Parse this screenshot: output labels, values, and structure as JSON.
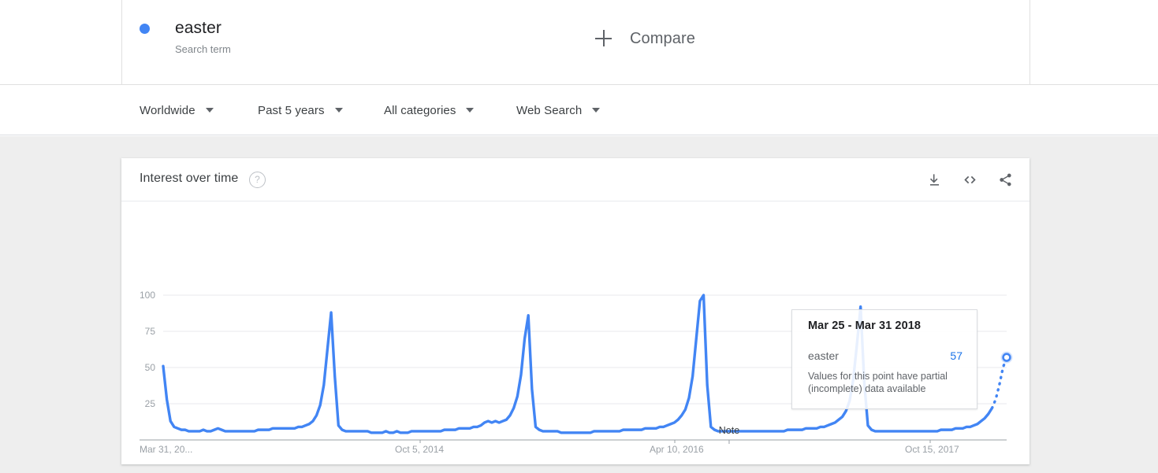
{
  "search_bar": {
    "term": {
      "name": "easter",
      "subtitle": "Search term",
      "dot_color": "#4285f4"
    },
    "compare": {
      "label": "Compare",
      "icon": "plus-icon"
    }
  },
  "filters": [
    {
      "label": "Worldwide",
      "name": "location"
    },
    {
      "label": "Past 5 years",
      "name": "time-range"
    },
    {
      "label": "All categories",
      "name": "category"
    },
    {
      "label": "Web Search",
      "name": "search-type"
    }
  ],
  "card": {
    "title": "Interest over time",
    "help_icon": "?",
    "actions": [
      {
        "name": "download-icon",
        "label": "Download"
      },
      {
        "name": "embed-icon",
        "label": "Embed"
      },
      {
        "name": "share-icon",
        "label": "Share"
      }
    ]
  },
  "tooltip": {
    "date_range": "Mar 25 - Mar 31 2018",
    "term": "easter",
    "value": "57",
    "note": "Values for this point have partial (incomplete) data available"
  },
  "chart_data": {
    "type": "line",
    "title": "Interest over time",
    "xlabel": "",
    "ylabel": "",
    "grid": true,
    "legend_position": "none",
    "line_color": "#4285f4",
    "ylim": [
      0,
      100
    ],
    "ytick_labels": [
      "100",
      "75",
      "50",
      "25"
    ],
    "ytick_values": [
      100,
      75,
      50,
      25
    ],
    "xtick_labels": [
      "Mar 31, 20...",
      "Oct 5, 2014",
      "Apr 10, 2016",
      "Oct 15, 2017"
    ],
    "annotations": [
      {
        "label": "Note",
        "x_index": 155
      }
    ],
    "hover_point": {
      "label": "Mar 25 - Mar 31 2018",
      "value": 57,
      "partial": true
    },
    "series": [
      {
        "name": "easter",
        "values": [
          51,
          28,
          13,
          9,
          8,
          7,
          7,
          6,
          6,
          6,
          6,
          7,
          6,
          6,
          7,
          8,
          7,
          6,
          6,
          6,
          6,
          6,
          6,
          6,
          6,
          6,
          7,
          7,
          7,
          7,
          8,
          8,
          8,
          8,
          8,
          8,
          8,
          9,
          9,
          10,
          11,
          13,
          17,
          24,
          38,
          63,
          88,
          44,
          10,
          7,
          6,
          6,
          6,
          6,
          6,
          6,
          6,
          5,
          5,
          5,
          5,
          6,
          5,
          5,
          6,
          5,
          5,
          5,
          6,
          6,
          6,
          6,
          6,
          6,
          6,
          6,
          6,
          7,
          7,
          7,
          7,
          8,
          8,
          8,
          8,
          9,
          9,
          10,
          12,
          13,
          12,
          13,
          12,
          13,
          14,
          17,
          22,
          30,
          45,
          70,
          86,
          35,
          9,
          7,
          6,
          6,
          6,
          6,
          6,
          5,
          5,
          5,
          5,
          5,
          5,
          5,
          5,
          5,
          6,
          6,
          6,
          6,
          6,
          6,
          6,
          6,
          7,
          7,
          7,
          7,
          7,
          7,
          8,
          8,
          8,
          8,
          9,
          9,
          10,
          11,
          12,
          14,
          17,
          21,
          29,
          44,
          70,
          96,
          100,
          38,
          9,
          7,
          6,
          6,
          6,
          6,
          6,
          6,
          6,
          6,
          6,
          6,
          6,
          6,
          6,
          6,
          6,
          6,
          6,
          6,
          6,
          7,
          7,
          7,
          7,
          7,
          8,
          8,
          8,
          8,
          9,
          9,
          10,
          11,
          12,
          14,
          16,
          20,
          27,
          42,
          66,
          92,
          40,
          10,
          7,
          6,
          6,
          6,
          6,
          6,
          6,
          6,
          6,
          6,
          6,
          6,
          6,
          6,
          6,
          6,
          6,
          6,
          6,
          7,
          7,
          7,
          7,
          8,
          8,
          8,
          9,
          9,
          10,
          11,
          13,
          15,
          18,
          22,
          28,
          38,
          50,
          57
        ]
      }
    ]
  }
}
